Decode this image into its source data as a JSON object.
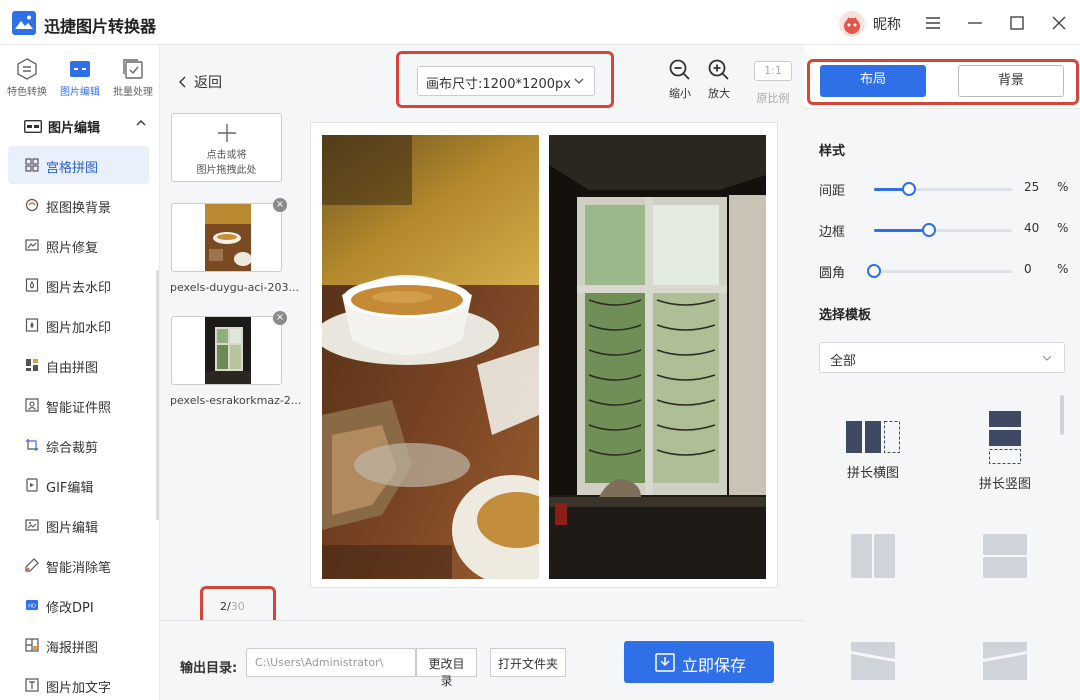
{
  "app": {
    "title": "迅捷图片转换器",
    "nickname": "昵称"
  },
  "top_modes": [
    {
      "label": "特色转换",
      "icon": "convert-icon"
    },
    {
      "label": "图片编辑",
      "icon": "image-edit-icon"
    },
    {
      "label": "批量处理",
      "icon": "batch-icon"
    }
  ],
  "nav": {
    "section_label": "图片编辑",
    "items": [
      {
        "label": "宫格拼图",
        "icon": "grid-icon"
      },
      {
        "label": "抠图换背景",
        "icon": "cutout-icon"
      },
      {
        "label": "照片修复",
        "icon": "photo-repair-icon"
      },
      {
        "label": "图片去水印",
        "icon": "remove-watermark-icon"
      },
      {
        "label": "图片加水印",
        "icon": "add-watermark-icon"
      },
      {
        "label": "自由拼图",
        "icon": "free-collage-icon"
      },
      {
        "label": "智能证件照",
        "icon": "id-photo-icon"
      },
      {
        "label": "综合裁剪",
        "icon": "crop-icon"
      },
      {
        "label": "GIF编辑",
        "icon": "gif-icon"
      },
      {
        "label": "图片编辑",
        "icon": "edit-icon"
      },
      {
        "label": "智能消除笔",
        "icon": "eraser-pen-icon"
      },
      {
        "label": "修改DPI",
        "icon": "dpi-icon"
      },
      {
        "label": "海报拼图",
        "icon": "poster-icon"
      },
      {
        "label": "图片加文字",
        "icon": "add-text-icon"
      }
    ]
  },
  "toolbar": {
    "back_label": "返回",
    "canvas_size": "画布尺寸:1200*1200px",
    "zoom_out_label": "缩小",
    "zoom_in_label": "放大",
    "ratio_box": "1:1",
    "ratio_label": "原比例"
  },
  "upload": {
    "line1": "点击或将",
    "line2": "图片拖拽此处"
  },
  "thumbnails": [
    {
      "name": "pexels-duygu-aci-203..."
    },
    {
      "name": "pexels-esrakorkmaz-2..."
    }
  ],
  "page_counter": {
    "current": "2/",
    "total": "30"
  },
  "footer": {
    "output_label": "输出目录:",
    "output_path": "C:\\Users\\Administrator\\",
    "change_dir": "更改目录",
    "open_folder": "打开文件夹",
    "save_label": "立即保存"
  },
  "right_panel": {
    "tabs": [
      "布局",
      "背景"
    ],
    "style_title": "样式",
    "sliders": [
      {
        "label": "间距",
        "value": 25,
        "unit": "%",
        "fraction": 0.25
      },
      {
        "label": "边框",
        "value": 40,
        "unit": "%",
        "fraction": 0.4
      },
      {
        "label": "圆角",
        "value": 0,
        "unit": "%",
        "fraction": 0.0
      }
    ],
    "template_title": "选择模板",
    "template_select": "全部",
    "templates": [
      {
        "label": "拼长横图"
      },
      {
        "label": "拼长竖图"
      }
    ]
  },
  "colors": {
    "accent": "#2f6fe8",
    "highlight": "#d6453a"
  }
}
